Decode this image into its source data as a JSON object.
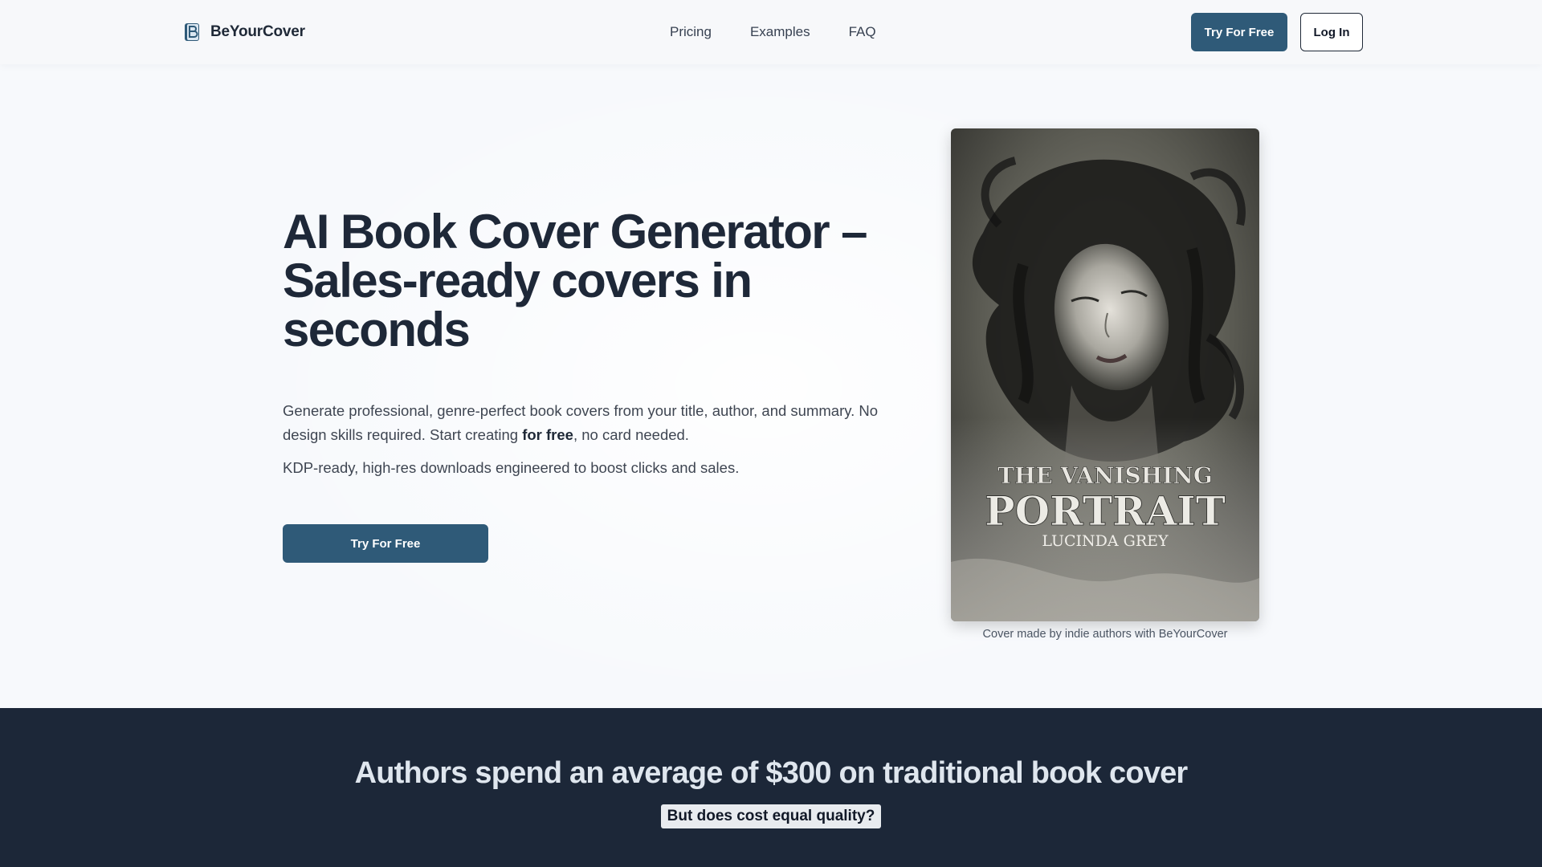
{
  "header": {
    "brand": "BeYourCover",
    "nav": [
      {
        "label": "Pricing"
      },
      {
        "label": "Examples"
      },
      {
        "label": "FAQ"
      }
    ],
    "cta_label": "Try For Free",
    "login_label": "Log In"
  },
  "hero": {
    "title": "AI Book Cover Generator – Sales-ready covers in seconds",
    "desc_prefix": "Generate professional, genre-perfect book covers from your title, author, and summary. No design skills required. Start creating ",
    "desc_bold": "for free",
    "desc_suffix": ", no card needed.",
    "sub": "KDP-ready, high-res downloads engineered to boost clicks and sales.",
    "cta_label": "Try For Free"
  },
  "cover": {
    "title_line1": "THE VANISHING",
    "title_line2": "PORTRAIT",
    "author": "LUCINDA GREY",
    "caption": "Cover made by indie authors with BeYourCover"
  },
  "cost_section": {
    "headline": "Authors spend an average of $300 on traditional book cover",
    "badge": "But does cost equal quality?"
  },
  "colors": {
    "primary": "#2f5a78",
    "dark_section": "#1c2738",
    "heading": "#1e2838"
  }
}
